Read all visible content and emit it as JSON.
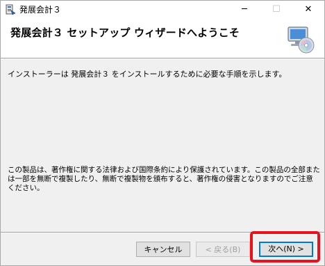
{
  "window": {
    "title": "発展会計３",
    "icon": "installer-app-icon",
    "controls": {
      "minimize": "─",
      "maximize": "☐",
      "close": "✕"
    }
  },
  "header": {
    "heading": "発展会計３ セットアップ ウィザードへようこそ",
    "icon": "cd-computer-icon"
  },
  "body": {
    "intro": "インストーラーは 発展会計３ をインストールするために必要な手順を示します。",
    "legal": "この製品は、著作権に関する法律および国際条約により保護されています。この製品の全部または一部を無断で複製したり、無断で複製物を頒布すると、著作権の侵害となりますのでご注意ください。"
  },
  "buttons": {
    "cancel": "キャンセル",
    "back": "< 戻る(B)",
    "next": "次へ(N) >"
  },
  "colors": {
    "highlight": "#e8121e",
    "focus_border": "#0078d7"
  }
}
